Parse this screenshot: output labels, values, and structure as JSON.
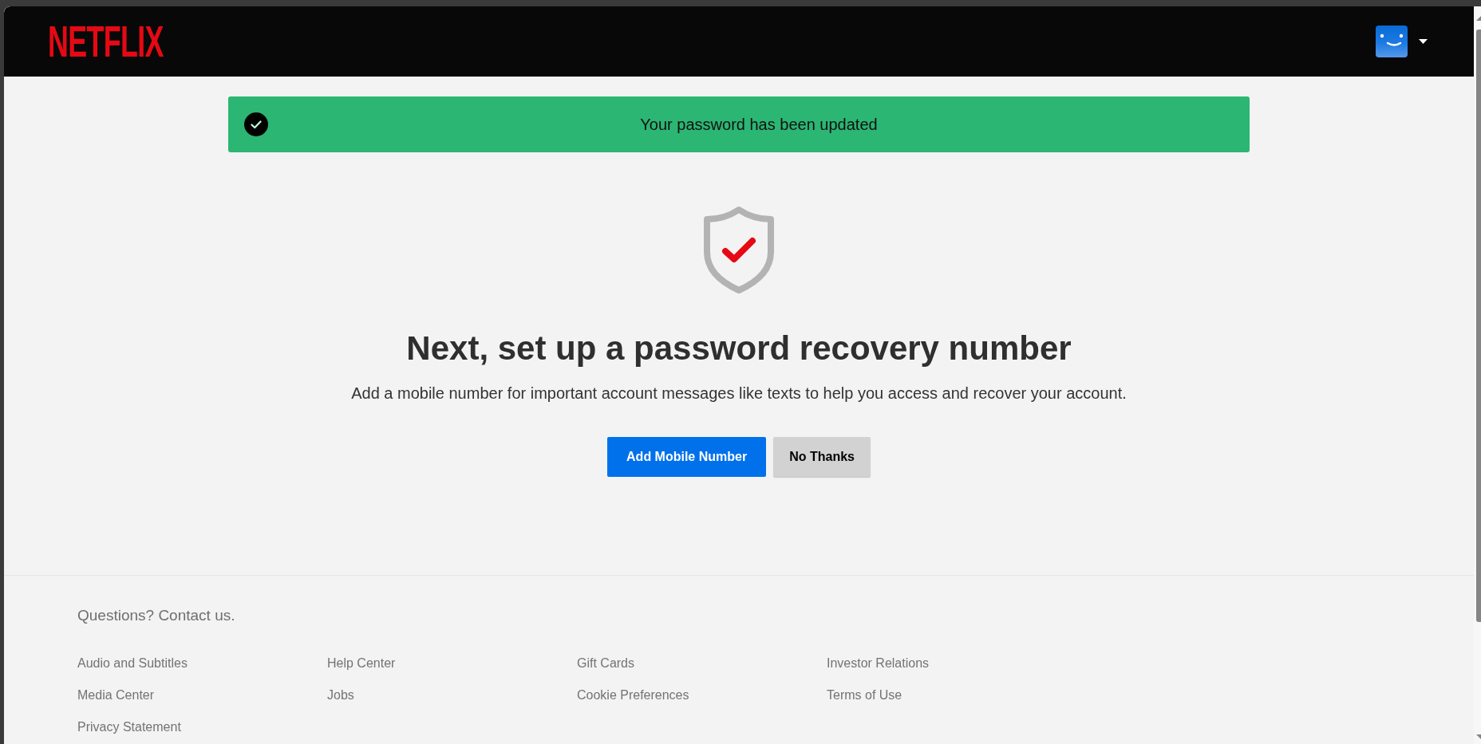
{
  "header": {
    "logo": "NETFLIX"
  },
  "alert": {
    "kind": "success",
    "message": "Your password has been updated"
  },
  "content": {
    "heading": "Next, set up a password recovery number",
    "description": "Add a mobile number for important account messages like texts to help you access and recover your account.",
    "buttons": [
      {
        "label": "Add Mobile Number",
        "kind": "primary"
      },
      {
        "label": "No Thanks",
        "kind": "secondary"
      }
    ]
  },
  "footer": {
    "contact": "Questions? Contact us.",
    "links": [
      "Audio and Subtitles",
      "Help Center",
      "Gift Cards",
      "Investor Relations",
      "Media Center",
      "Jobs",
      "Cookie Preferences",
      "Terms of Use",
      "Privacy Statement"
    ]
  }
}
